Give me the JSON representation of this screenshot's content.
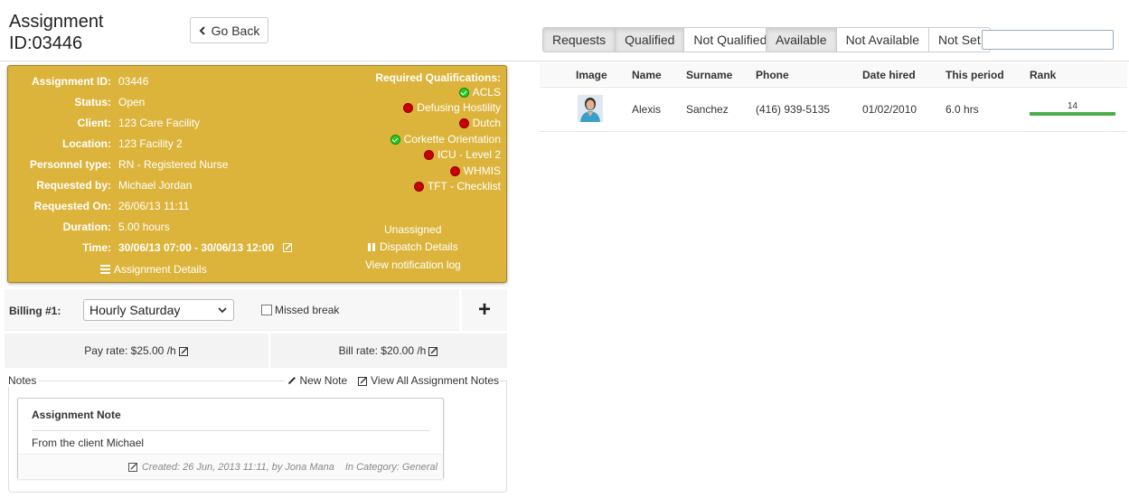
{
  "header": {
    "title_line1": "Assignment",
    "title_line2": "ID:03446",
    "go_back_label": "Go Back"
  },
  "filters": {
    "group1": [
      {
        "label": "Requests",
        "active": true
      },
      {
        "label": "Qualified",
        "active": true
      },
      {
        "label": "Not Qualified",
        "active": false
      }
    ],
    "group2": [
      {
        "label": "Available",
        "active": true
      },
      {
        "label": "Not Available",
        "active": false
      },
      {
        "label": "Not Set",
        "active": false
      }
    ],
    "search_value": ""
  },
  "assignment": {
    "rows": [
      {
        "label": "Assignment ID:",
        "value": "03446"
      },
      {
        "label": "Status:",
        "value": "Open"
      },
      {
        "label": "Client:",
        "value": "123 Care Facility"
      },
      {
        "label": "Location:",
        "value": "123 Facility 2"
      },
      {
        "label": "Personnel type:",
        "value": "RN - Registered Nurse"
      },
      {
        "label": "Requested by:",
        "value": "Michael Jordan"
      },
      {
        "label": "Requested On:",
        "value": "26/06/13 11:11"
      },
      {
        "label": "Duration:",
        "value": "5.00 hours"
      },
      {
        "label": "Time:",
        "value": "30/06/13 07:00 - 30/06/13 12:00"
      }
    ],
    "assignment_details_label": "Assignment Details",
    "quals_heading": "Required Qualifications:",
    "qualifications": [
      {
        "name": "ACLS",
        "status": "green"
      },
      {
        "name": "Defusing Hostility",
        "status": "red"
      },
      {
        "name": "Dutch",
        "status": "red"
      },
      {
        "name": "Corkette Orientation",
        "status": "green"
      },
      {
        "name": "ICU - Level 2",
        "status": "red"
      },
      {
        "name": "WHMIS",
        "status": "red"
      },
      {
        "name": "TFT - Checklist",
        "status": "red"
      }
    ],
    "unassigned_label": "Unassigned",
    "dispatch_label": "Dispatch Details",
    "notification_label": "View notification log",
    "card_color": "#dcb43c"
  },
  "billing": {
    "label": "Billing #1:",
    "selected": "Hourly Saturday",
    "missed_break_label": "Missed break",
    "missed_break_checked": false,
    "add_label": "+",
    "pay_rate": "Pay rate: $25.00 /h",
    "bill_rate": "Bill rate: $20.00 /h"
  },
  "notes": {
    "title": "Notes",
    "new_note_label": "New Note",
    "view_all_label": "View All Assignment Notes",
    "card": {
      "title": "Assignment Note",
      "body": "From the client Michael",
      "created": "Created: 26 Jun, 2013 11:11, by Jona Mana",
      "category": "In Category: General"
    }
  },
  "table": {
    "columns": [
      "Image",
      "Name",
      "Surname",
      "Phone",
      "Date hired",
      "This period",
      "Rank"
    ],
    "rows": [
      {
        "name": "Alexis",
        "surname": "Sanchez",
        "phone": "(416) 939-5135",
        "date_hired": "01/02/2010",
        "this_period": "6.0 hrs",
        "rank": "14",
        "rank_fill": 1.0
      }
    ]
  }
}
